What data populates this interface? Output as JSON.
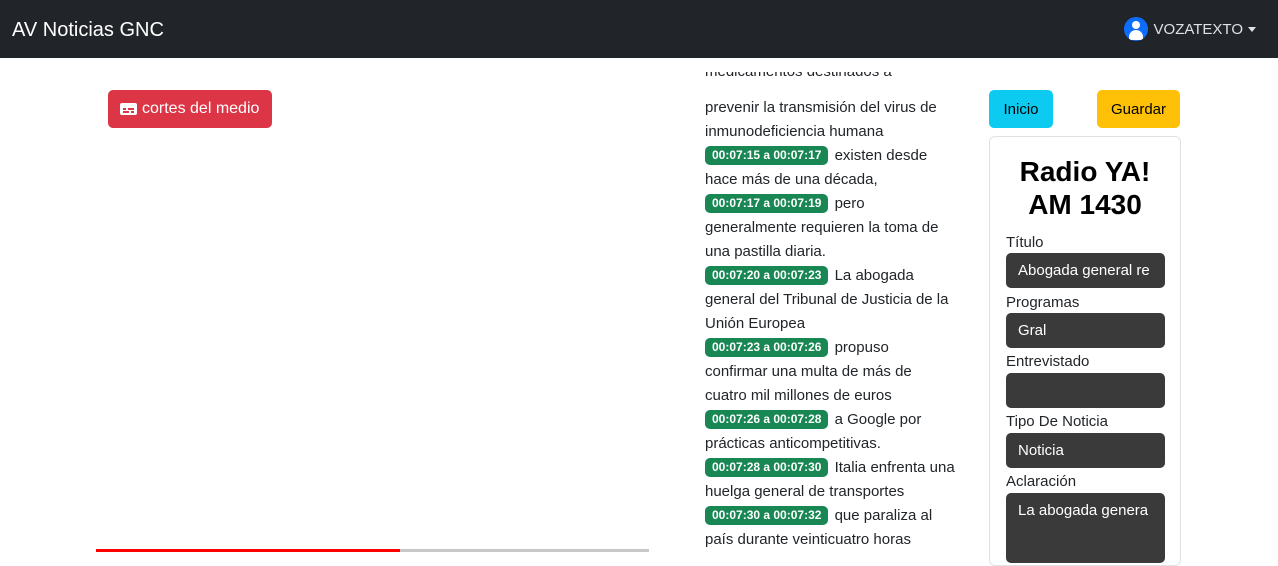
{
  "navbar": {
    "brand": "AV Noticias GNC",
    "user_name": "VOZATEXTO"
  },
  "media": {
    "cortes_label": "cortes del medio",
    "playback_progress_percent": 55
  },
  "transcript": {
    "partial_top_line": "medicamentos destinados a",
    "opening_text": "prevenir la transmisión del virus de inmunodeficiencia humana",
    "segments": [
      {
        "time": "00:07:15 a 00:07:17",
        "text": "existen desde hace más de una década,"
      },
      {
        "time": "00:07:17 a 00:07:19",
        "text": "pero generalmente requieren la toma de una pastilla diaria."
      },
      {
        "time": "00:07:20 a 00:07:23",
        "text": "La abogada general del Tribunal de Justicia de la Unión Europea"
      },
      {
        "time": "00:07:23 a 00:07:26",
        "text": "propuso confirmar una multa de más de cuatro mil millones de euros"
      },
      {
        "time": "00:07:26 a 00:07:28",
        "text": "a Google por prácticas anticompetitivas."
      },
      {
        "time": "00:07:28 a 00:07:30",
        "text": "Italia enfrenta una huelga general de transportes"
      },
      {
        "time": "00:07:30 a 00:07:32",
        "text": "que paraliza al país durante veinticuatro horas"
      }
    ]
  },
  "actions": {
    "inicio_label": "Inicio",
    "guardar_label": "Guardar"
  },
  "form": {
    "station_line1": "Radio YA!",
    "station_line2": "AM 1430",
    "titulo_label": "Título",
    "titulo_value": "Abogada general re",
    "programas_label": "Programas",
    "programas_value": "Gral",
    "entrevistado_label": "Entrevistado",
    "entrevistado_value": "",
    "tipo_label": "Tipo De Noticia",
    "tipo_value": "Noticia",
    "aclaracion_label": "Aclaración",
    "aclaracion_value": "La abogada genera"
  },
  "colors": {
    "navbar": "#212529",
    "danger": "#dc3545",
    "info": "#0dcaf0",
    "warning": "#ffc107",
    "timestamp_badge": "#198754",
    "progress": "#ff0000",
    "field_bg": "#3a3a3a"
  }
}
